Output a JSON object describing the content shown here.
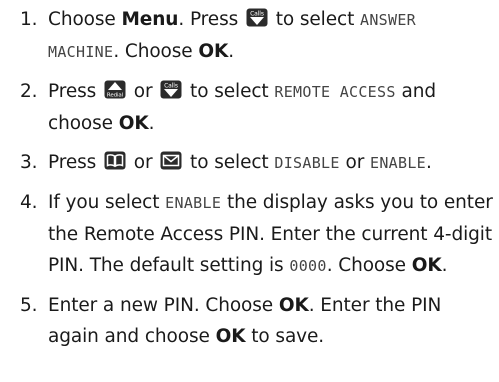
{
  "steps": [
    {
      "number": "1.",
      "parts": {
        "a": "Choose ",
        "b": "Menu",
        "c": ". Press ",
        "d": " to select ",
        "e": "ANSWER MACHINE",
        "f": ". Choose ",
        "g": "OK",
        "h": "."
      }
    },
    {
      "number": "2.",
      "parts": {
        "a": "Press ",
        "b": " or ",
        "c": " to select ",
        "d": "REMOTE ACCESS",
        "e": " and choose ",
        "f": "OK",
        "g": "."
      }
    },
    {
      "number": "3.",
      "parts": {
        "a": "Press ",
        "b": " or ",
        "c": " to select ",
        "d": "DISABLE",
        "e": " or ",
        "f": "ENABLE",
        "g": "."
      }
    },
    {
      "number": "4.",
      "parts": {
        "a": "If you select ",
        "b": "ENABLE",
        "c": " the display asks you to enter the Remote Access PIN. Enter the current 4-digit PIN. The default setting is ",
        "d": "0000",
        "e": ". Choose ",
        "f": "OK",
        "g": "."
      }
    },
    {
      "number": "5.",
      "parts": {
        "a": "Enter a new PIN. Choose ",
        "b": "OK",
        "c": ". Enter the PIN again and choose ",
        "d": "OK",
        "e": " to save."
      }
    }
  ],
  "icons": {
    "calls_label": "Calls",
    "redial_label": "Redial",
    "calls_icon": "calls-down-key-icon",
    "redial_icon": "redial-up-key-icon",
    "phonebook_icon": "phonebook-key-icon",
    "message_icon": "message-envelope-key-icon"
  },
  "colors": {
    "text": "#1a1a1a",
    "lcd_text": "#444444"
  }
}
